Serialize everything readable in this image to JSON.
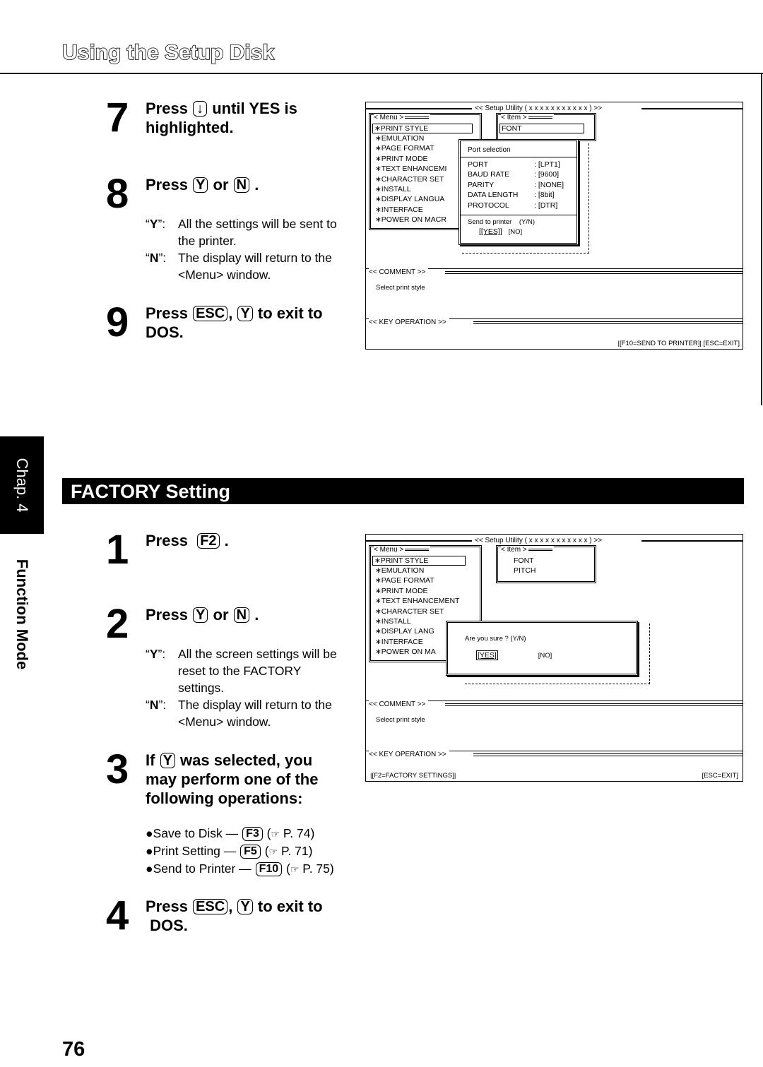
{
  "header": {
    "title": "Using the Setup Disk"
  },
  "side_tab": {
    "chapter": "Chap. 4",
    "section": "Function Mode"
  },
  "top_steps": [
    {
      "num": "7",
      "pre": "Press",
      "key": "↓",
      "post": "until YES is",
      "line2": "highlighted."
    },
    {
      "num": "8",
      "pre": "Press",
      "key1": "Y",
      "mid": "or",
      "key2": "N",
      "post": "."
    },
    {
      "num": "9",
      "pre": "Press",
      "key1": "ESC",
      "mid": ",",
      "key2": "Y",
      "post": "to exit to",
      "line2": "DOS."
    }
  ],
  "step8_desc": [
    {
      "label": "Y",
      "text": "All the settings will be sent to the printer."
    },
    {
      "label": "N",
      "text": "The display will return to the <Menu> window."
    }
  ],
  "screen1": {
    "title": "<< Setup Utility ( x x x x x x x x x x x ) >>",
    "menu_label": "< Menu >",
    "menu_items": [
      "∗PRINT STYLE",
      "∗EMULATION",
      "∗PAGE FORMAT",
      "∗PRINT MODE",
      "∗TEXT ENHANCEMI",
      "∗CHARACTER SET",
      "∗INSTALL",
      "∗DISPLAY LANGUA",
      "∗INTERFACE",
      "∗POWER ON MACR"
    ],
    "item_label": "< Item >",
    "item_items": [
      "FONT"
    ],
    "dialog": {
      "title": "Port selection",
      "rows": [
        {
          "key": "PORT",
          "value": ": [LPT1]"
        },
        {
          "key": "BAUD RATE",
          "value": ": [9600]"
        },
        {
          "key": "PARITY",
          "value": ": [NONE]"
        },
        {
          "key": "DATA LENGTH",
          "value": ": [8bit]"
        },
        {
          "key": "PROTOCOL",
          "value": ": [DTR]"
        }
      ],
      "prompt": "Send to printer    (Y/N)",
      "yes": "[[YES]]",
      "no": "[NO]"
    },
    "comment_label": "<< COMMENT >>",
    "comment_text": "Select print style",
    "keyop_label": "<< KEY OPERATION >>",
    "keyop_text": "|[F10=SEND TO PRINTER]| [ESC=EXIT]"
  },
  "factory": {
    "title": "FACTORY Setting",
    "steps": [
      {
        "num": "1",
        "pre": "Press",
        "key": "F2",
        "post": "."
      },
      {
        "num": "2",
        "pre": "Press",
        "key1": "Y",
        "mid": "or",
        "key2": "N",
        "post": "."
      },
      {
        "num": "3",
        "pre": "If",
        "key": "Y",
        "post": "was selected, you",
        "line2": "may perform one of the",
        "line3": "following operations:"
      },
      {
        "num": "4",
        "pre": "Press",
        "key1": "ESC",
        "mid": ",",
        "key2": "Y",
        "post": "to exit to",
        "line2": "DOS."
      }
    ],
    "step2_desc": [
      {
        "label": "Y",
        "text": "All the screen settings will be reset to the FACTORY settings."
      },
      {
        "label": "N",
        "text": "The display will return to the <Menu> window."
      }
    ],
    "operations": [
      {
        "text": "Save to Disk —",
        "key": "F3",
        "ref": "P. 74"
      },
      {
        "text": "Print Setting —",
        "key": "F5",
        "ref": "P. 71"
      },
      {
        "text": "Send to Printer —",
        "key": "F10",
        "ref": "P. 75"
      }
    ]
  },
  "screen2": {
    "title": "<< Setup Utility ( x x x x x x x x x x x ) >>",
    "menu_label": "< Menu >",
    "menu_items": [
      "∗PRINT STYLE",
      "∗EMULATION",
      "∗PAGE FORMAT",
      "∗PRINT MODE",
      "∗TEXT ENHANCEMENT",
      "∗CHARACTER SET",
      "∗INSTALL",
      "∗DISPLAY LANG",
      "∗INTERFACE",
      "∗POWER ON MA"
    ],
    "item_label": "< Item >",
    "item_items": [
      "FONT",
      "PITCH"
    ],
    "dialog": {
      "prompt": "Are you sure ? (Y/N)",
      "yes": "[YES]",
      "no": "[NO]"
    },
    "comment_label": "<< COMMENT >>",
    "comment_text": "Select print style",
    "keyop_label": "<< KEY OPERATION >>",
    "keyop_left": "|[F2=FACTORY SETTINGS]|",
    "keyop_right": "[ESC=EXIT]"
  },
  "page_number": "76"
}
